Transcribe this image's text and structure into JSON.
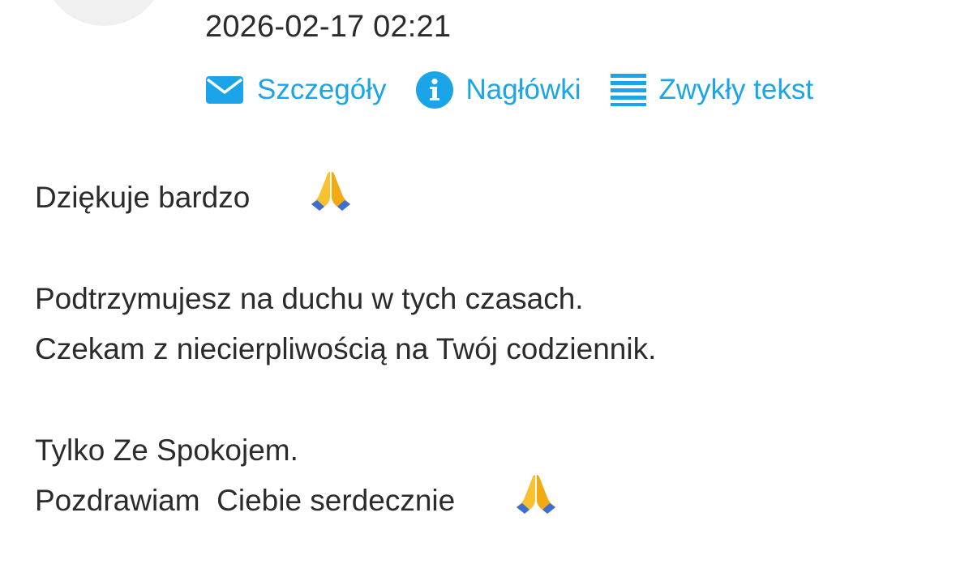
{
  "message": {
    "timestamp": "2026-02-17 02:21"
  },
  "actions": {
    "details_label": "Szczegóły",
    "headers_label": "Nagłówki",
    "plaintext_label": "Zwykły tekst"
  },
  "icons": {
    "details": "envelope-icon",
    "headers": "info-icon",
    "plaintext": "lines-icon",
    "emoji": "folded-hands-emoji"
  },
  "colors": {
    "accent": "#1ca4e8",
    "text": "#2b2b2b"
  },
  "body": {
    "line1": "Dziękuje bardzo",
    "line2": "Podtrzymujesz na duchu w tych czasach.",
    "line3": "Czekam z niecierpliwością na Twój codziennik.",
    "line4": "Tylko Ze Spokojem.",
    "line5": "Pozdrawiam  Ciebie serdecznie"
  }
}
